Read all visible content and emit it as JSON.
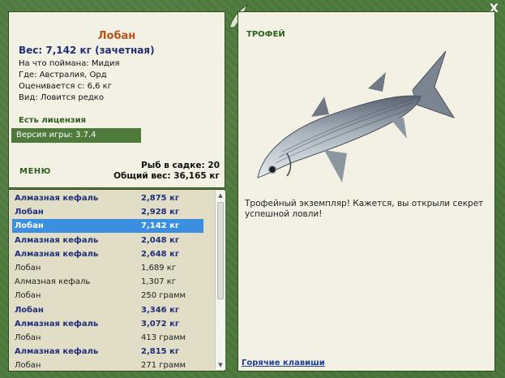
{
  "fish": {
    "name": "Лобан",
    "weight": "Вес: 7,142 кг (зачетная)",
    "bait": "На что поймана: Мидия",
    "location": "Где: Австралия, Орд",
    "value": "Оценивается с: 6,6 кг",
    "rarity": "Вид: Ловится редко"
  },
  "license": "Есть лицензия",
  "version": "Версия игры: 3.7.4",
  "menu_label": "МЕНЮ",
  "stats": {
    "fish_count": "Рыб в садке: 20",
    "total_weight": "Общий вес: 36,165 кг"
  },
  "trophy": {
    "label": "ТРОФЕЙ",
    "message": "Трофейный экземпляр! Кажется, вы открыли секрет успешной ловли!"
  },
  "hotkeys": "Горячие клавиши",
  "close_label": "X",
  "catch_list": [
    {
      "name": "Алмазная кефаль",
      "weight": "2,875 кг",
      "style": "hl"
    },
    {
      "name": "Лобан",
      "weight": "2,928 кг",
      "style": "hl"
    },
    {
      "name": "Лобан",
      "weight": "7,142 кг",
      "style": "sel"
    },
    {
      "name": "Алмазная кефаль",
      "weight": "2,048 кг",
      "style": "hl"
    },
    {
      "name": "Алмазная кефаль",
      "weight": "2,648 кг",
      "style": "hl"
    },
    {
      "name": "Лобан",
      "weight": "1,689 кг",
      "style": "norm"
    },
    {
      "name": "Алмазная кефаль",
      "weight": "1,307 кг",
      "style": "norm"
    },
    {
      "name": "Лобан",
      "weight": "250 грамм",
      "style": "norm"
    },
    {
      "name": "Лобан",
      "weight": "3,346 кг",
      "style": "hl"
    },
    {
      "name": "Алмазная кефаль",
      "weight": "3,072 кг",
      "style": "hl"
    },
    {
      "name": "Лобан",
      "weight": "413 грамм",
      "style": "norm"
    },
    {
      "name": "Алмазная кефаль",
      "weight": "2,815 кг",
      "style": "hl"
    },
    {
      "name": "Лобан",
      "weight": "271 грамм",
      "style": "norm"
    }
  ],
  "colors": {
    "frame": "#4e7a3c",
    "panel": "#f3f1e3",
    "list_bg": "#e1ddc7",
    "highlight_text": "#1f2f7a",
    "selected_bg": "#3a8fe0",
    "title": "#b5531c",
    "label_green": "#2d5f1e"
  }
}
